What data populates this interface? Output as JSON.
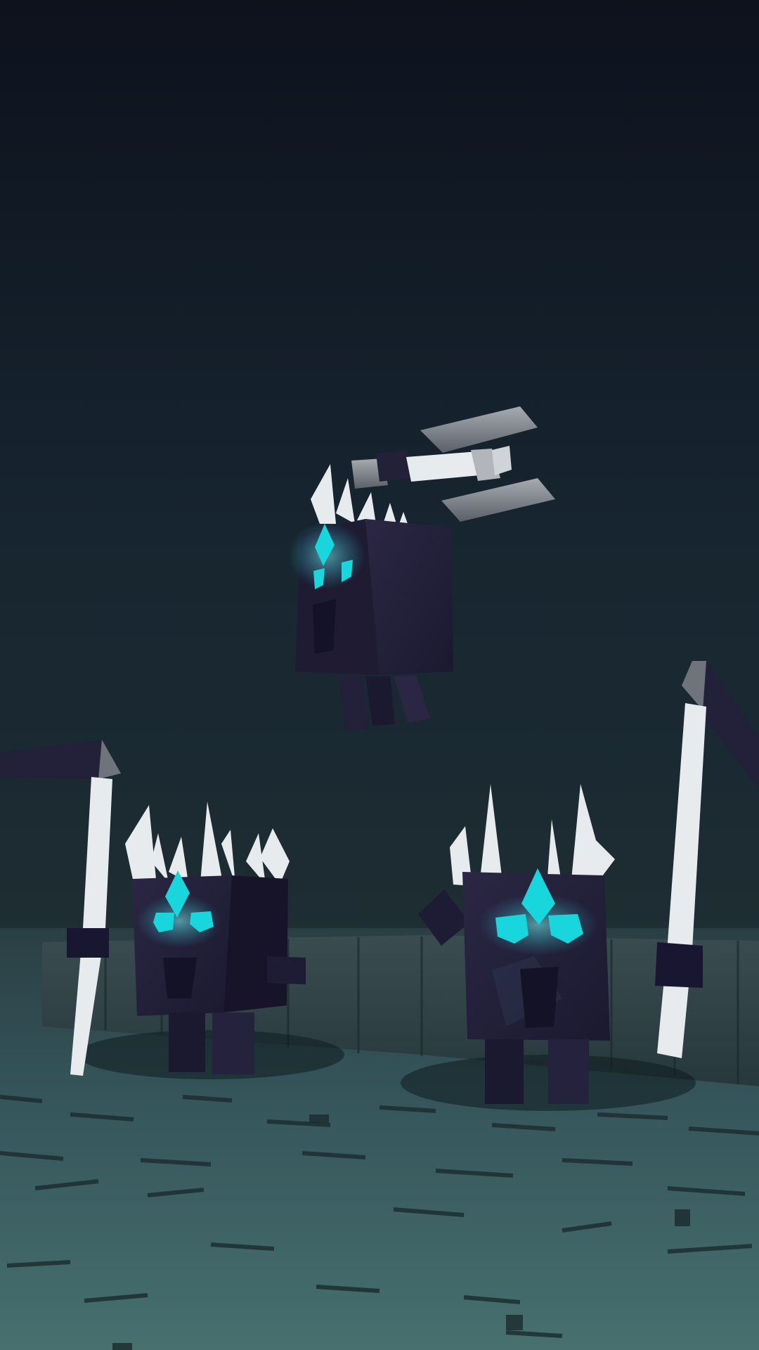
{
  "scene": {
    "subjects": [
      {
        "kind": "floating-golem",
        "eye_color": "#18d6dc"
      },
      {
        "kind": "left-golem",
        "eye_color": "#18d6dc"
      },
      {
        "kind": "right-golem",
        "eye_color": "#18d6dc"
      }
    ],
    "weapons": [
      "scythe-left",
      "scythe-right",
      "claw-arm"
    ],
    "palette": {
      "sky_top": "#0d121d",
      "sky_bottom": "#1c2c33",
      "floor_near": "#3f6464",
      "floor_far": "#2a3f44",
      "wall": "#33454a",
      "body": "#231f38",
      "body_dark": "#171429",
      "spike": "#e8ebee",
      "eye": "#18d6dc",
      "eye_glow": "#7ff6f6",
      "metal": "#6f737b",
      "metal_light": "#a7abb1"
    }
  }
}
